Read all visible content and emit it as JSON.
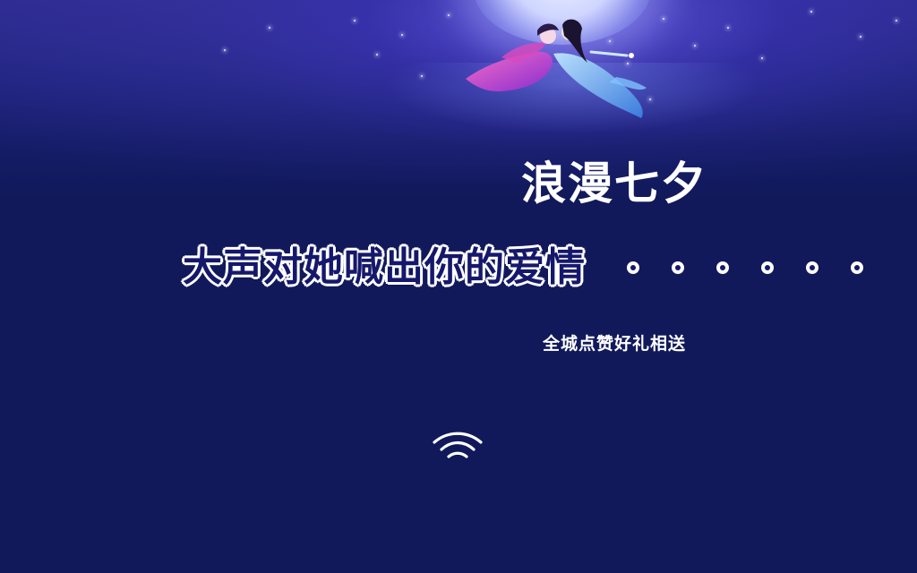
{
  "banner": {
    "title": "浪漫七夕",
    "headline": "大声对她喊出你的爱情",
    "trailing_marks_count": 6,
    "subline": "全城点赞好礼相送"
  },
  "decorations": {
    "hero_art": "moon-and-flying-couple",
    "signal_icon": "wifi-icon"
  },
  "colors": {
    "background": "#11195a",
    "title_text": "#ffffff",
    "headline_fill": "#15186a",
    "headline_outline": "#ffffff"
  }
}
